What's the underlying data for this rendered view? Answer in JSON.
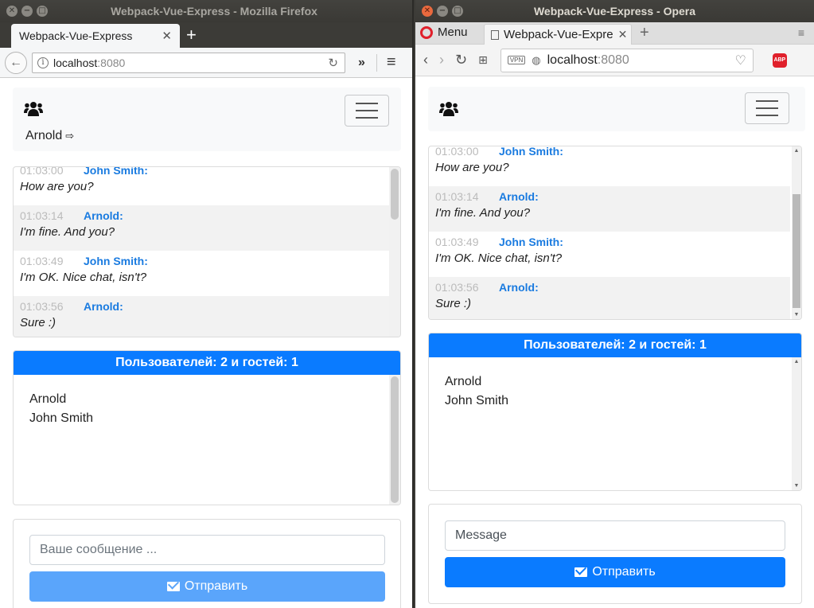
{
  "desktop": {
    "firefox": {
      "window_title": "Webpack-Vue-Express - Mozilla Firefox",
      "tab_title": "Webpack-Vue-Express",
      "url_host": "localhost",
      "url_port": ":8080"
    },
    "opera": {
      "window_title": "Webpack-Vue-Express - Opera",
      "menu_label": "Menu",
      "tab_title": "Webpack-Vue-Expre",
      "url_host": "localhost",
      "url_port": ":8080",
      "adblock_label": "ABP"
    }
  },
  "icons": {
    "window_close": "✕",
    "window_minimize": "−",
    "window_maximize": "□",
    "tab_close": "✕",
    "new_tab": "+",
    "back": "←",
    "forward": "›",
    "reload": "↻",
    "overflow": "»",
    "menu": "≡",
    "heart": "♡",
    "logout": "⇨"
  },
  "app_firefox": {
    "nav_user": "Arnold",
    "messages": [
      {
        "time": "01:03:00",
        "author": "John Smith:",
        "text": "How are you?"
      },
      {
        "time": "01:03:14",
        "author": "Arnold:",
        "text": "I'm fine. And you?"
      },
      {
        "time": "01:03:49",
        "author": "John Smith:",
        "text": "I'm OK. Nice chat, isn't?"
      },
      {
        "time": "01:03:56",
        "author": "Arnold:",
        "text": "Sure :)"
      }
    ],
    "users_header": "Пользователей: 2 и гостей: 1",
    "users": [
      "Arnold",
      "John Smith"
    ],
    "input_placeholder": "Ваше сообщение ...",
    "send_label": "Отправить"
  },
  "app_opera": {
    "messages": [
      {
        "time": "01:03:00",
        "author": "John Smith:",
        "text": "How are you?"
      },
      {
        "time": "01:03:14",
        "author": "Arnold:",
        "text": "I'm fine. And you?"
      },
      {
        "time": "01:03:49",
        "author": "John Smith:",
        "text": "I'm OK. Nice chat, isn't?"
      },
      {
        "time": "01:03:56",
        "author": "Arnold:",
        "text": "Sure :)"
      }
    ],
    "users_header": "Пользователей: 2 и гостей: 1",
    "users": [
      "Arnold",
      "John Smith"
    ],
    "input_placeholder": "Message",
    "send_label": "Отправить"
  },
  "colors": {
    "primary": "#0a7bff",
    "primary_disabled": "#5aa5fb",
    "author": "#1a7be0",
    "alt_row": "#f2f2f2"
  }
}
